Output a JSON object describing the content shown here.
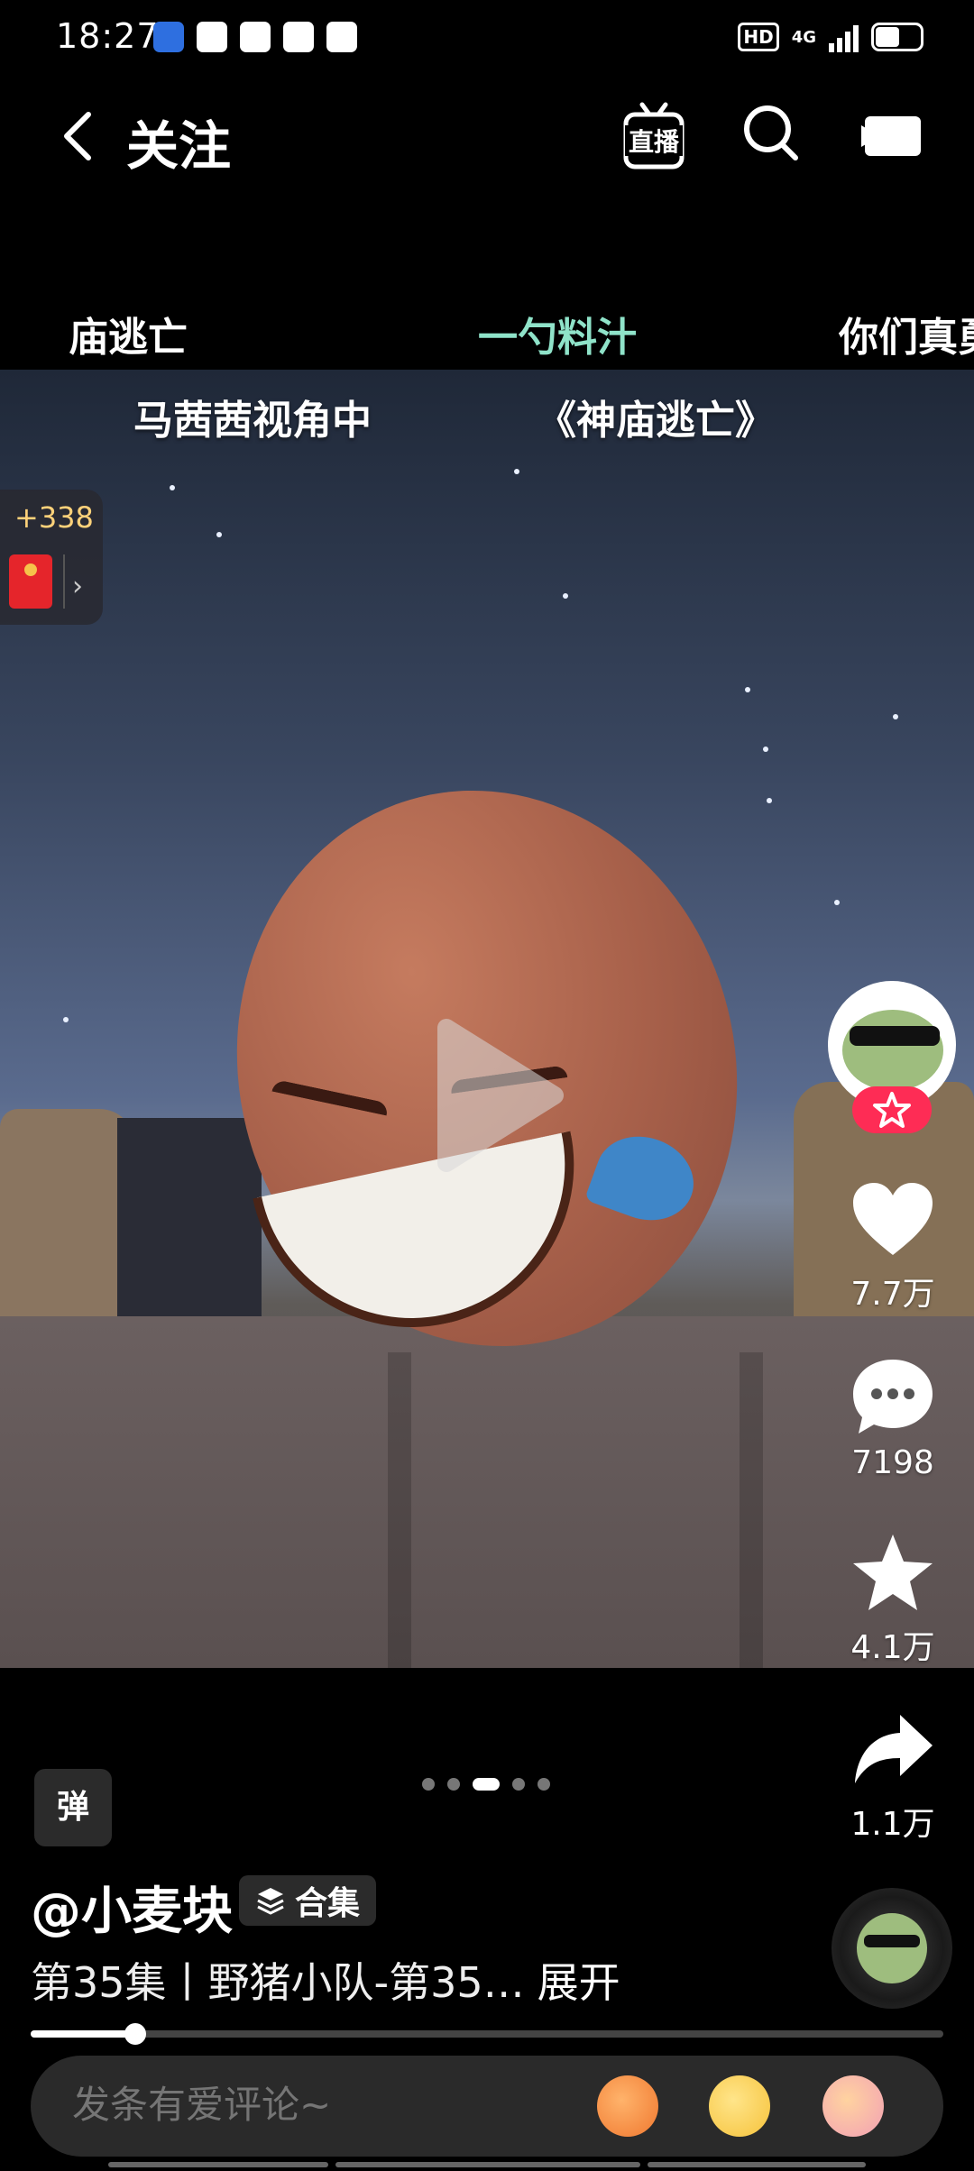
{
  "status_bar": {
    "time": "18:27",
    "network": "4G",
    "hd": "HD"
  },
  "header": {
    "title": "关注",
    "live_label": "直播"
  },
  "tabs": [
    {
      "label": "庙逃亡"
    },
    {
      "label": "一勺料汁"
    },
    {
      "label": "你们真勇"
    }
  ],
  "video": {
    "captions": [
      "马茜茜视角中",
      "《神庙逃亡》"
    ]
  },
  "reward": {
    "amount": "+338"
  },
  "actions": {
    "likes": "7.7万",
    "comments": "7198",
    "favorites": "4.1万",
    "shares": "1.1万"
  },
  "badge": {
    "text": "弹"
  },
  "pager": {
    "count": 5,
    "active_index": 2
  },
  "author": {
    "name": "@小麦块",
    "collection_label": "合集"
  },
  "description": {
    "text": "第35集丨野猪小队-第35…",
    "expand_label": "展开"
  },
  "playback": {
    "progress": 0.115
  },
  "comment_bar": {
    "placeholder": "发条有爱评论~"
  },
  "colors": {
    "active_tab": "#8fe3c9",
    "follow": "#fe2c55",
    "reward": "#ffd27a"
  }
}
